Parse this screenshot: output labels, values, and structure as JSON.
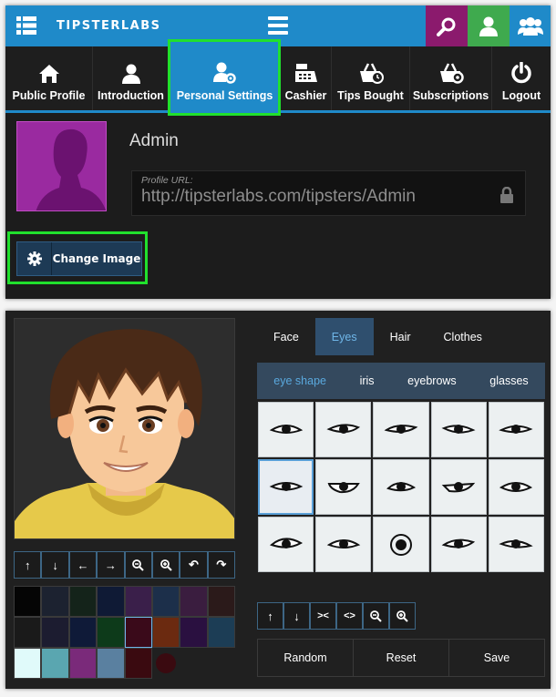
{
  "header": {
    "brand": "TIPSTERLABS"
  },
  "nav": [
    {
      "label": "Public Profile",
      "icon": "home-icon"
    },
    {
      "label": "Introduction",
      "icon": "person-icon"
    },
    {
      "label": "Personal Settings",
      "icon": "user-gear-icon",
      "active": true
    },
    {
      "label": "Cashier",
      "icon": "cash-register-icon"
    },
    {
      "label": "Tips Bought",
      "icon": "basket-clock-icon"
    },
    {
      "label": "Subscriptions",
      "icon": "basket-gear-icon"
    },
    {
      "label": "Logout",
      "icon": "power-icon"
    }
  ],
  "profile": {
    "name": "Admin",
    "url_label": "Profile URL:",
    "url": "http://tipsterlabs.com/tipsters/Admin",
    "change_image_label": "Change Image"
  },
  "editor": {
    "tabs": [
      "Face",
      "Eyes",
      "Hair",
      "Clothes"
    ],
    "active_tab": "Eyes",
    "subtabs": [
      "eye shape",
      "iris",
      "eyebrows",
      "glasses"
    ],
    "active_subtab": "eye shape",
    "actions": [
      "Random",
      "Reset",
      "Save"
    ],
    "colors": [
      "#050505",
      "#1c2230",
      "#14231a",
      "#0f1a35",
      "#3a1f4a",
      "#1c2f4a",
      "#3a1d3f",
      "#2b1a1a",
      "#1a1a1a",
      "#1c1c30",
      "#0f1a38",
      "#0d3a1a",
      "#3a0a1a",
      "#6b2a10",
      "#2a1040",
      "#1c3d55",
      "#e0fafa",
      "#5aa6b0",
      "#7a2a7a",
      "#5a80a0",
      "#3a0a10"
    ],
    "selected_color": "#3a0a1a"
  }
}
